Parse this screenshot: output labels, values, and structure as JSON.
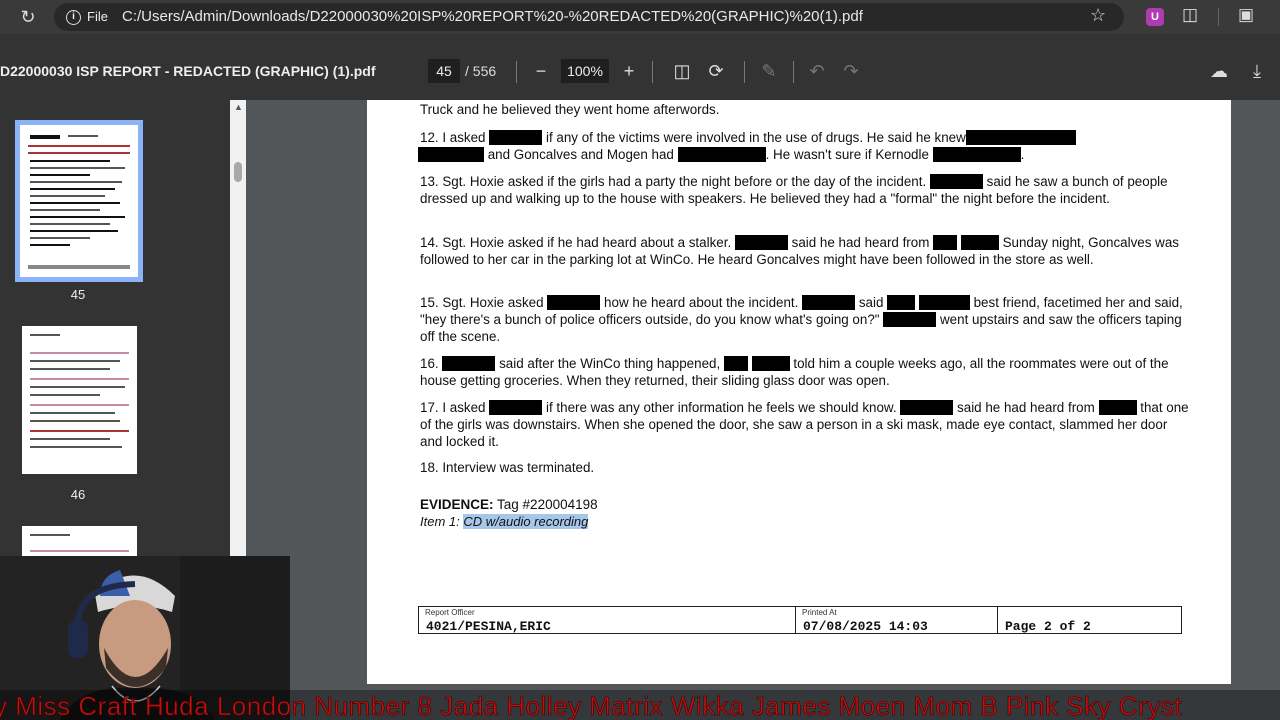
{
  "browser": {
    "file_chip": "File",
    "url": "C:/Users/Admin/Downloads/D22000030%20ISP%20REPORT%20-%20REDACTED%20(GRAPHIC)%20(1).pdf",
    "extension_badge": "U"
  },
  "pdf_toolbar": {
    "title": "D22000030 ISP REPORT - REDACTED (GRAPHIC) (1).pdf",
    "page_current": "45",
    "page_total": "/ 556",
    "zoom": "100%"
  },
  "sidebar": {
    "thumbnails": [
      {
        "label": "45",
        "selected": true
      },
      {
        "label": "46",
        "selected": false
      }
    ]
  },
  "document": {
    "p11_tail": "Truck and he believed they went home afterwords.",
    "p12": {
      "a": "12.  I asked",
      "b": "if any of the victims were involved in the use of drugs. He said he knew",
      "c": "and Goncalves and Mogen had",
      "d": ". He wasn't sure if Kernodle",
      "e": "."
    },
    "p13": {
      "a": "13. Sgt. Hoxie asked if the girls had a party the night before or the day of the incident.",
      "b": "said he saw a bunch of people dressed up and walking up to the house with speakers. He believed they had a \"formal\" the night before the incident."
    },
    "p14": {
      "a": "14. Sgt. Hoxie asked if he had heard about a stalker.",
      "b": "said he had heard from",
      "c": "Sunday night, Goncalves was followed to her car in the parking lot at WinCo. He heard Goncalves might have been followed in the store as well."
    },
    "p15": {
      "a": "15. Sgt. Hoxie asked",
      "b": "how he heard about the incident.",
      "c": "said",
      "d": "best friend, facetimed her and said, \"hey there's a bunch of police officers outside, do you know what's going on?\"",
      "e": "went upstairs and saw the officers taping off the scene."
    },
    "p16": {
      "a": "16.",
      "b": "said after the WinCo thing happened,",
      "c": "told him a couple weeks ago, all the roommates were out of the house getting groceries. When they returned, their sliding glass door was open."
    },
    "p17": {
      "a": "17. I asked",
      "b": "if there was any other information he feels we should know.",
      "c": "said he had heard from",
      "d": "that one of the girls was downstairs. When she opened the door, she saw a person in a ski mask, made eye contact, slammed her door and locked it."
    },
    "p18": "18. Interview was terminated.",
    "evidence_label": "EVIDENCE:",
    "evidence_tag": "Tag #220004198",
    "item_label": "Item 1:",
    "item_value": "CD w/audio recording",
    "footer": {
      "officer_caption": "Report Officer",
      "officer_value": "4021/PESINA,ERIC",
      "printed_caption": "Printed At",
      "printed_value": "07/08/2025 14:03",
      "page_value": "Page 2 of 2"
    }
  },
  "ticker": {
    "text": "y Miss Craft Huda London  Number 8  Jada Holley Matrix Wikka James Moen Mom B  Pink Sky  Cryst"
  },
  "colors": {
    "viewer_bg": "#525659",
    "toolbar_bg": "#333333",
    "selection_highlight": "#a7c7ea",
    "thumb_selected": "#8ab4f8",
    "ticker_text": "#c01010"
  }
}
